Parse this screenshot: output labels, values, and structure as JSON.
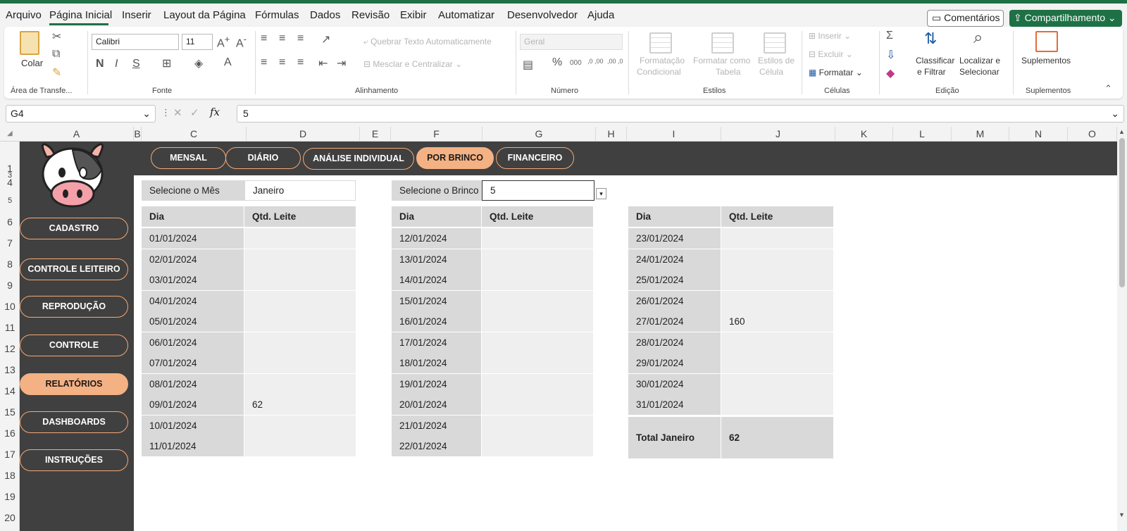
{
  "menu": {
    "items": [
      "Arquivo",
      "Página Inicial",
      "Inserir",
      "Layout da Página",
      "Fórmulas",
      "Dados",
      "Revisão",
      "Exibir",
      "Automatizar",
      "Desenvolvedor",
      "Ajuda"
    ],
    "active": "Página Inicial",
    "comments_label": "Comentários",
    "share_label": "Compartilhamento"
  },
  "ribbon": {
    "clipboard": {
      "paste_label": "Colar",
      "group_label": "Área de Transfe..."
    },
    "font": {
      "font_name": "Calibri",
      "font_size": "11",
      "bold": "N",
      "italic": "I",
      "underline": "S",
      "group_label": "Fonte"
    },
    "alignment": {
      "wrap_label": "Quebrar Texto Automaticamente",
      "merge_label": "Mesclar e Centralizar",
      "group_label": "Alinhamento"
    },
    "number": {
      "format": "Geral",
      "percent": "%",
      "thousands": "000",
      "inc_dec": ",0 ,00",
      "dec_dec": ",00 ,0",
      "group_label": "Número"
    },
    "styles": {
      "cond_line1": "Formatação",
      "cond_line2": "Condicional",
      "table_line1": "Formatar como",
      "table_line2": "Tabela",
      "cell_line1": "Estilos de",
      "cell_line2": "Célula",
      "group_label": "Estilos"
    },
    "cells": {
      "insert_label": "Inserir",
      "delete_label": "Excluir",
      "format_label": "Formatar",
      "group_label": "Células"
    },
    "editing": {
      "sort_line1": "Classificar",
      "sort_line2": "e Filtrar",
      "find_line1": "Localizar e",
      "find_line2": "Selecionar",
      "group_label": "Edição"
    },
    "addins": {
      "label": "Suplementos",
      "group_label": "Suplementos"
    }
  },
  "formula_bar": {
    "name_box": "G4",
    "fx": "fx",
    "value": "5"
  },
  "columns": [
    "A",
    "B",
    "C",
    "D",
    "E",
    "F",
    "G",
    "H",
    "I",
    "J",
    "K",
    "L",
    "M",
    "N",
    "O"
  ],
  "rows": [
    "1",
    "3",
    "4",
    "5",
    "6",
    "7",
    "8",
    "9",
    "10",
    "11",
    "12",
    "13",
    "14",
    "15",
    "16",
    "17",
    "18",
    "19",
    "20"
  ],
  "tabs": [
    "MENSAL",
    "DIÁRIO",
    "ANÁLISE INDIVIDUAL",
    "POR BRINCO",
    "FINANCEIRO"
  ],
  "active_tab": "POR BRINCO",
  "sidebar": [
    "CADASTRO",
    "CONTROLE LEITEIRO",
    "REPRODUÇÃO",
    "CONTROLE",
    "RELATÓRIOS",
    "DASHBOARDS",
    "INSTRUÇÕES"
  ],
  "active_sidebar": "RELATÓRIOS",
  "selectors": {
    "month_label": "Selecione o Mês",
    "month_value": "Janeiro",
    "tag_label": "Selecione o Brinco",
    "tag_value": "5"
  },
  "tables": {
    "header_day": "Dia",
    "header_qty": "Qtd. Leite",
    "table1": [
      {
        "dia": "01/01/2024",
        "qtd": ""
      },
      {
        "dia": "02/01/2024",
        "qtd": ""
      },
      {
        "dia": "03/01/2024",
        "qtd": ""
      },
      {
        "dia": "04/01/2024",
        "qtd": ""
      },
      {
        "dia": "05/01/2024",
        "qtd": ""
      },
      {
        "dia": "06/01/2024",
        "qtd": ""
      },
      {
        "dia": "07/01/2024",
        "qtd": ""
      },
      {
        "dia": "08/01/2024",
        "qtd": ""
      },
      {
        "dia": "09/01/2024",
        "qtd": "62"
      },
      {
        "dia": "10/01/2024",
        "qtd": ""
      },
      {
        "dia": "11/01/2024",
        "qtd": ""
      }
    ],
    "table2": [
      {
        "dia": "12/01/2024",
        "qtd": ""
      },
      {
        "dia": "13/01/2024",
        "qtd": ""
      },
      {
        "dia": "14/01/2024",
        "qtd": ""
      },
      {
        "dia": "15/01/2024",
        "qtd": ""
      },
      {
        "dia": "16/01/2024",
        "qtd": ""
      },
      {
        "dia": "17/01/2024",
        "qtd": ""
      },
      {
        "dia": "18/01/2024",
        "qtd": ""
      },
      {
        "dia": "19/01/2024",
        "qtd": ""
      },
      {
        "dia": "20/01/2024",
        "qtd": ""
      },
      {
        "dia": "21/01/2024",
        "qtd": ""
      },
      {
        "dia": "22/01/2024",
        "qtd": ""
      }
    ],
    "table3": [
      {
        "dia": "23/01/2024",
        "qtd": ""
      },
      {
        "dia": "24/01/2024",
        "qtd": ""
      },
      {
        "dia": "25/01/2024",
        "qtd": ""
      },
      {
        "dia": "26/01/2024",
        "qtd": ""
      },
      {
        "dia": "27/01/2024",
        "qtd": "160"
      },
      {
        "dia": "28/01/2024",
        "qtd": ""
      },
      {
        "dia": "29/01/2024",
        "qtd": ""
      },
      {
        "dia": "30/01/2024",
        "qtd": ""
      },
      {
        "dia": "31/01/2024",
        "qtd": ""
      }
    ],
    "total_label": "Total Janeiro",
    "total_value": "62"
  },
  "colors": {
    "accent_green": "#1e7145",
    "dark_panel": "#404040",
    "pill_orange": "#f4b183"
  }
}
